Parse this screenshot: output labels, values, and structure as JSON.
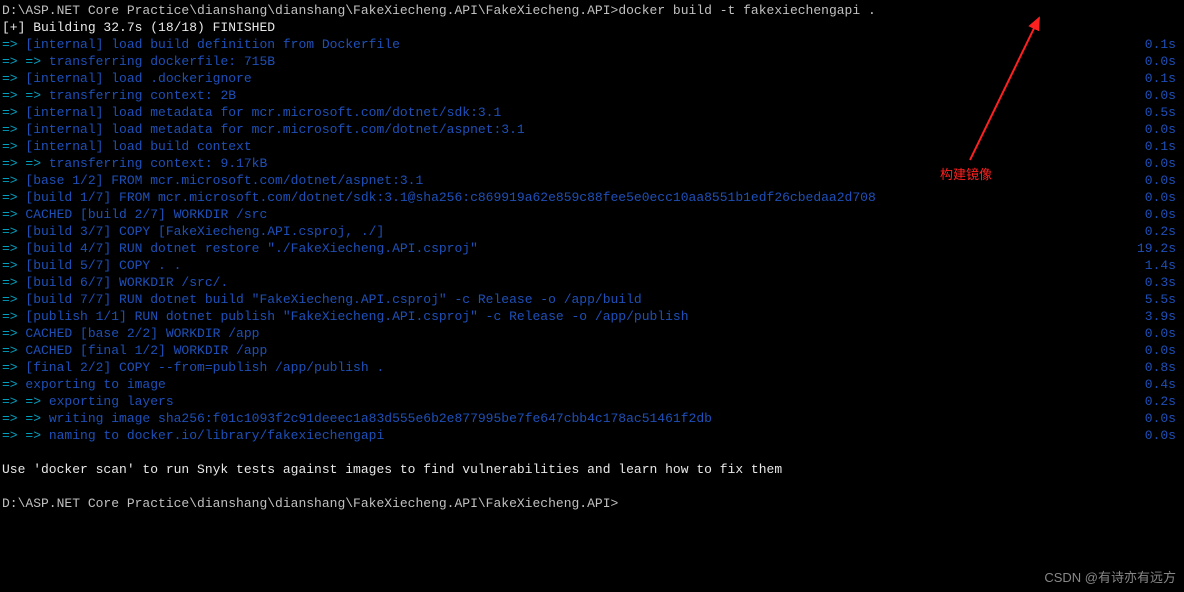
{
  "prompt_line": {
    "path": "D:\\ASP.NET Core Practice\\dianshang\\dianshang\\FakeXiecheng.API\\FakeXiecheng.API>",
    "command": "docker build -t fakexiechengapi ."
  },
  "build_header": "[+] Building 32.7s (18/18) FINISHED",
  "lines": [
    {
      "arrow": "=> ",
      "text": "[internal] load build definition from Dockerfile",
      "time": "0.1s"
    },
    {
      "arrow": "=> => ",
      "text": "transferring dockerfile: 715B",
      "time": "0.0s"
    },
    {
      "arrow": "=> ",
      "text": "[internal] load .dockerignore",
      "time": "0.1s"
    },
    {
      "arrow": "=> => ",
      "text": "transferring context: 2B",
      "time": "0.0s"
    },
    {
      "arrow": "=> ",
      "text": "[internal] load metadata for mcr.microsoft.com/dotnet/sdk:3.1",
      "time": "0.5s"
    },
    {
      "arrow": "=> ",
      "text": "[internal] load metadata for mcr.microsoft.com/dotnet/aspnet:3.1",
      "time": "0.0s"
    },
    {
      "arrow": "=> ",
      "text": "[internal] load build context",
      "time": "0.1s"
    },
    {
      "arrow": "=> => ",
      "text": "transferring context: 9.17kB",
      "time": "0.0s"
    },
    {
      "arrow": "=> ",
      "text": "[base 1/2] FROM mcr.microsoft.com/dotnet/aspnet:3.1",
      "time": "0.0s"
    },
    {
      "arrow": "=> ",
      "text": "[build 1/7] FROM mcr.microsoft.com/dotnet/sdk:3.1@sha256:c869919a62e859c88fee5e0ecc10aa8551b1edf26cbedaa2d708",
      "time": "0.0s"
    },
    {
      "arrow": "=> ",
      "text": "CACHED [build 2/7] WORKDIR /src",
      "time": "0.0s"
    },
    {
      "arrow": "=> ",
      "text": "[build 3/7] COPY [FakeXiecheng.API.csproj, ./]",
      "time": "0.2s"
    },
    {
      "arrow": "=> ",
      "text": "[build 4/7] RUN dotnet restore \"./FakeXiecheng.API.csproj\"",
      "time": "19.2s"
    },
    {
      "arrow": "=> ",
      "text": "[build 5/7] COPY . .",
      "time": "1.4s"
    },
    {
      "arrow": "=> ",
      "text": "[build 6/7] WORKDIR /src/.",
      "time": "0.3s"
    },
    {
      "arrow": "=> ",
      "text": "[build 7/7] RUN dotnet build \"FakeXiecheng.API.csproj\" -c Release -o /app/build",
      "time": "5.5s"
    },
    {
      "arrow": "=> ",
      "text": "[publish 1/1] RUN dotnet publish \"FakeXiecheng.API.csproj\" -c Release -o /app/publish",
      "time": "3.9s"
    },
    {
      "arrow": "=> ",
      "text": "CACHED [base 2/2] WORKDIR /app",
      "time": "0.0s"
    },
    {
      "arrow": "=> ",
      "text": "CACHED [final 1/2] WORKDIR /app",
      "time": "0.0s"
    },
    {
      "arrow": "=> ",
      "text": "[final 2/2] COPY --from=publish /app/publish .",
      "time": "0.8s"
    },
    {
      "arrow": "=> ",
      "text": "exporting to image",
      "time": "0.4s"
    },
    {
      "arrow": "=> => ",
      "text": "exporting layers",
      "time": "0.2s"
    },
    {
      "arrow": "=> => ",
      "text": "writing image sha256:f01c1093f2c91deeec1a83d555e6b2e877995be7fe647cbb4c178ac51461f2db",
      "time": "0.0s"
    },
    {
      "arrow": "=> => ",
      "text": "naming to docker.io/library/fakexiechengapi",
      "time": "0.0s"
    }
  ],
  "scan_hint": "Use 'docker scan' to run Snyk tests against images to find vulnerabilities and learn how to fix them",
  "prompt_line2": "D:\\ASP.NET Core Practice\\dianshang\\dianshang\\FakeXiecheng.API\\FakeXiecheng.API>",
  "annotation_text": "构建镜像",
  "watermark": "CSDN @有诗亦有远方"
}
